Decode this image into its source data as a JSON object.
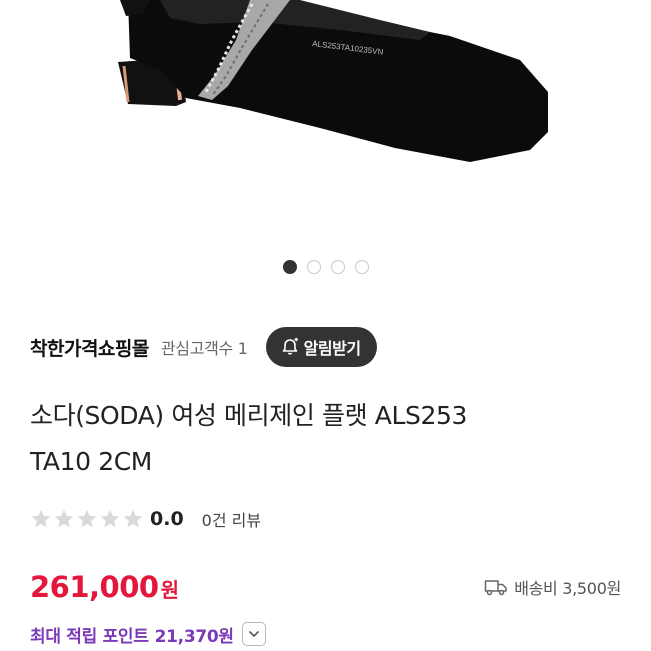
{
  "product_image": {
    "sole_code_text": "ALS253TA10235VN",
    "color": "#000000"
  },
  "carousel": {
    "total": 4,
    "active_index": 0
  },
  "seller": {
    "name": "착한가격쇼핑몰",
    "interest_label": "관심고객수 1",
    "alarm_button_label": "알림받기"
  },
  "product": {
    "title_line1": "소다(SODA) 여성 메리제인 플랫 ALS253",
    "title_line2": "TA10 2CM"
  },
  "rating": {
    "score": "0.0",
    "stars_filled": 0,
    "stars_total": 5,
    "review_count_label": "0건 리뷰"
  },
  "price": {
    "amount": "261,000",
    "unit": "원",
    "color": "#e3173b"
  },
  "shipping": {
    "label": "배송비 3,500원",
    "icon": "truck-icon"
  },
  "points": {
    "label": "최대 적립 포인트",
    "amount": "21,370원",
    "color": "#7b3ab8"
  }
}
